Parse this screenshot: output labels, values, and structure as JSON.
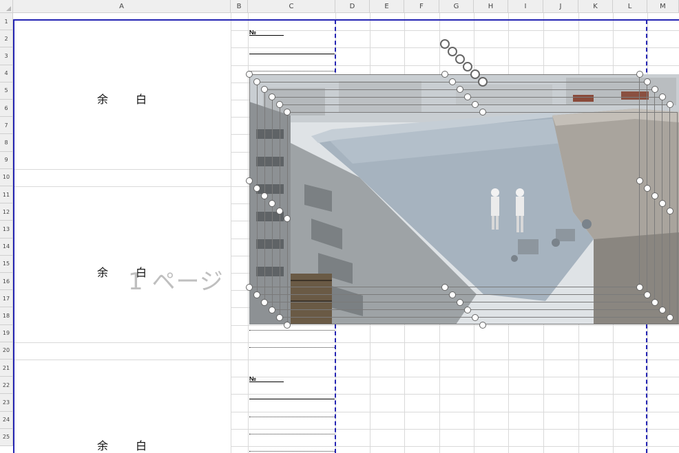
{
  "columns": [
    "A",
    "B",
    "C",
    "D",
    "E",
    "F",
    "G",
    "H",
    "I",
    "J",
    "K",
    "L",
    "M"
  ],
  "rows": [
    "1",
    "2",
    "3",
    "4",
    "5",
    "6",
    "7",
    "8",
    "9",
    "10",
    "11",
    "12",
    "13",
    "14",
    "15",
    "16",
    "17",
    "18",
    "19",
    "20",
    "21",
    "22",
    "23",
    "24",
    "25"
  ],
  "blank_sections": [
    {
      "chars": [
        "余",
        "白"
      ]
    },
    {
      "chars": [
        "余",
        "白"
      ]
    },
    {
      "chars": [
        "余",
        "白"
      ]
    }
  ],
  "no_labels": [
    "№",
    "№"
  ],
  "watermark": "1 ページ",
  "photo": {
    "description_icon": "photo-rooftop-construction",
    "sky": "#e9ecef",
    "roof": "#a9b7c3",
    "concrete": "#9ea3a6"
  },
  "colors": {
    "page_break": "#2424b3",
    "header_bg": "#efefef",
    "grid": "#d9d9d9"
  }
}
